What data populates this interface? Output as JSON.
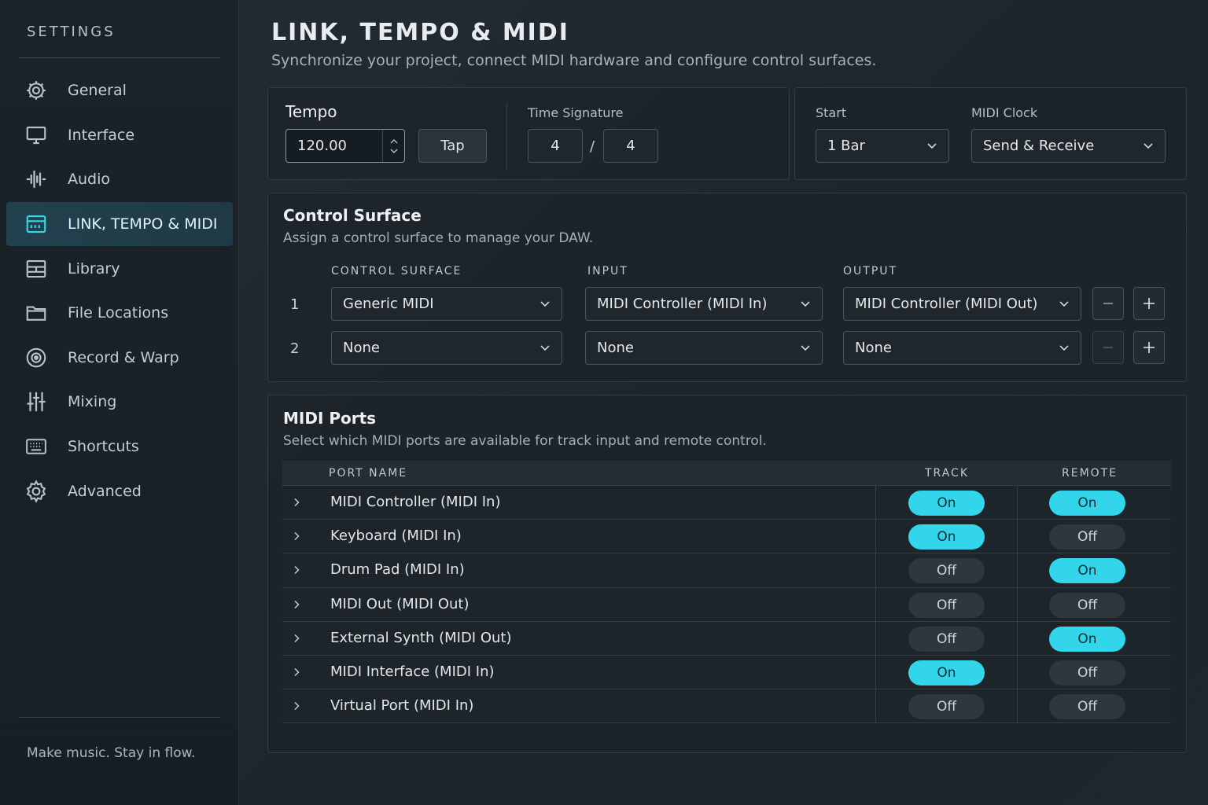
{
  "sidebar": {
    "title": "SETTINGS",
    "items": [
      {
        "label": "General",
        "icon": "gear-icon",
        "active": false
      },
      {
        "label": "Interface",
        "icon": "monitor-icon",
        "active": false
      },
      {
        "label": "Audio",
        "icon": "waveform-icon",
        "active": false
      },
      {
        "label": "LINK, TEMPO & MIDI",
        "icon": "midi-icon",
        "active": true
      },
      {
        "label": "Library",
        "icon": "library-icon",
        "active": false
      },
      {
        "label": "File Locations",
        "icon": "folder-icon",
        "active": false
      },
      {
        "label": "Record & Warp",
        "icon": "record-icon",
        "active": false
      },
      {
        "label": "Mixing",
        "icon": "mixer-icon",
        "active": false
      },
      {
        "label": "Shortcuts",
        "icon": "keyboard-icon",
        "active": false
      },
      {
        "label": "Advanced",
        "icon": "advanced-gear-icon",
        "active": false
      }
    ],
    "tagline": "Make music. Stay in flow."
  },
  "page": {
    "title": "LINK, TEMPO & MIDI",
    "subtitle": "Synchronize your project, connect MIDI hardware and configure control surfaces."
  },
  "tempo": {
    "label": "Tempo",
    "value": "120.00",
    "tap_label": "Tap",
    "time_signature_label": "Time Signature",
    "numerator": "4",
    "separator": "/",
    "denominator": "4"
  },
  "sync": {
    "start_label": "Start",
    "start_value": "1 Bar",
    "midi_clock_label": "MIDI Clock",
    "midi_clock_value": "Send & Receive"
  },
  "control_surface": {
    "title": "Control Surface",
    "subtitle": "Assign a control surface to manage your DAW.",
    "headers": {
      "surface": "CONTROL SURFACE",
      "input": "INPUT",
      "output": "OUTPUT"
    },
    "rows": [
      {
        "index": "1",
        "surface": "Generic MIDI",
        "input": "MIDI Controller (MIDI In)",
        "output": "MIDI Controller (MIDI Out)"
      },
      {
        "index": "2",
        "surface": "None",
        "input": "None",
        "output": "None"
      }
    ]
  },
  "midi_ports": {
    "title": "MIDI Ports",
    "subtitle": "Select which MIDI ports are available for track input and remote control.",
    "headers": {
      "name": "PORT NAME",
      "track": "TRACK",
      "remote": "REMOTE"
    },
    "rows": [
      {
        "name": "MIDI Controller (MIDI In)",
        "track": "On",
        "remote": "On"
      },
      {
        "name": "Keyboard (MIDI In)",
        "track": "On",
        "remote": "Off"
      },
      {
        "name": "Drum Pad (MIDI In)",
        "track": "Off",
        "remote": "On"
      },
      {
        "name": "MIDI Out (MIDI Out)",
        "track": "Off",
        "remote": "Off"
      },
      {
        "name": "External Synth (MIDI Out)",
        "track": "Off",
        "remote": "On"
      },
      {
        "name": "MIDI Interface (MIDI In)",
        "track": "On",
        "remote": "Off"
      },
      {
        "name": "Virtual Port (MIDI In)",
        "track": "Off",
        "remote": "Off"
      }
    ]
  },
  "colors": {
    "accent": "#33d5ea",
    "active_nav": "#22414e"
  }
}
